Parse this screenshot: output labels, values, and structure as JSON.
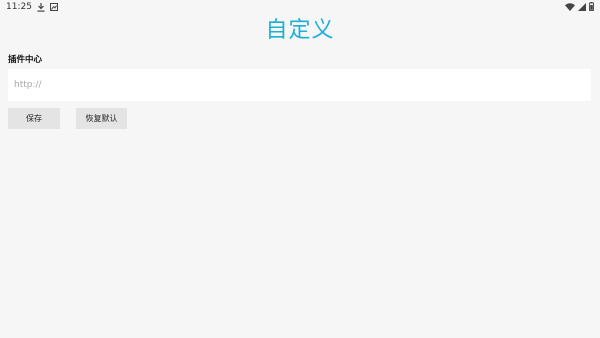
{
  "status_bar": {
    "time": "11:25",
    "icons_left": [
      "download-icon",
      "notification-icon"
    ],
    "icons_right": [
      "wifi-icon",
      "signal-icon",
      "battery-icon"
    ]
  },
  "header": {
    "title": "自定义",
    "title_color": "#1ab0d8"
  },
  "plugin_section": {
    "label": "插件中心",
    "input_value": "",
    "input_placeholder": "http://"
  },
  "actions": {
    "save_label": "保存",
    "reset_label": "恢复默认"
  }
}
